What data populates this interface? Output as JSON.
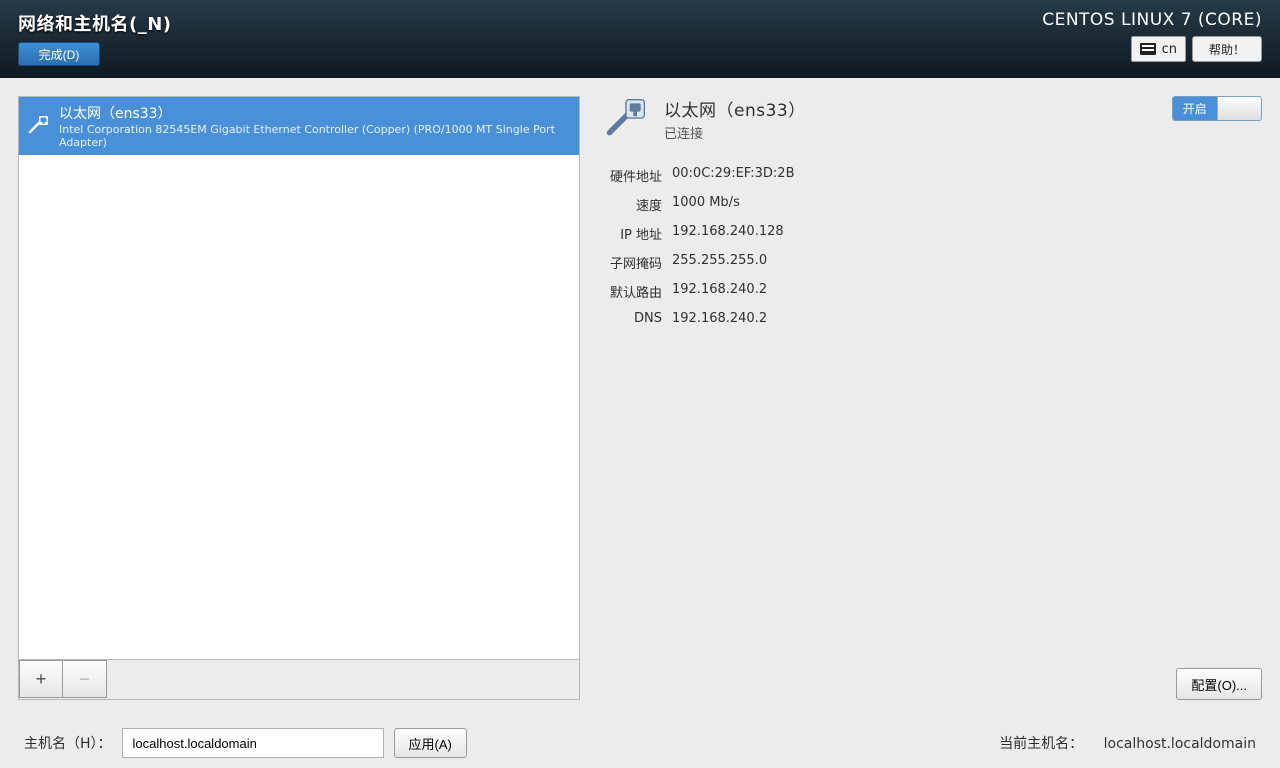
{
  "header": {
    "screen_title": "网络和主机名(_N)",
    "done_label": "完成(D)",
    "distro": "CENTOS LINUX 7 (CORE)",
    "keyboard_layout": "cn",
    "help_label": "帮助！"
  },
  "interface_list": {
    "items": [
      {
        "name": "以太网（ens33）",
        "description": "Intel Corporation 82545EM Gigabit Ethernet Controller (Copper) (PRO/1000 MT Single Port Adapter)"
      }
    ],
    "add_label": "+",
    "remove_label": "−"
  },
  "detail": {
    "title": "以太网（ens33）",
    "status": "已连接",
    "toggle_on_label": "开启",
    "rows": [
      {
        "label": "硬件地址",
        "value": "00:0C:29:EF:3D:2B"
      },
      {
        "label": "速度",
        "value": "1000 Mb/s"
      },
      {
        "label": "IP 地址",
        "value": "192.168.240.128"
      },
      {
        "label": "子网掩码",
        "value": "255.255.255.0"
      },
      {
        "label": "默认路由",
        "value": "192.168.240.2"
      },
      {
        "label": "DNS",
        "value": "192.168.240.2"
      }
    ],
    "configure_label": "配置(O)..."
  },
  "hostname": {
    "label": "主机名（H）：",
    "value": "localhost.localdomain",
    "apply_label": "应用(A)",
    "current_label": "当前主机名：",
    "current_value": "localhost.localdomain"
  }
}
